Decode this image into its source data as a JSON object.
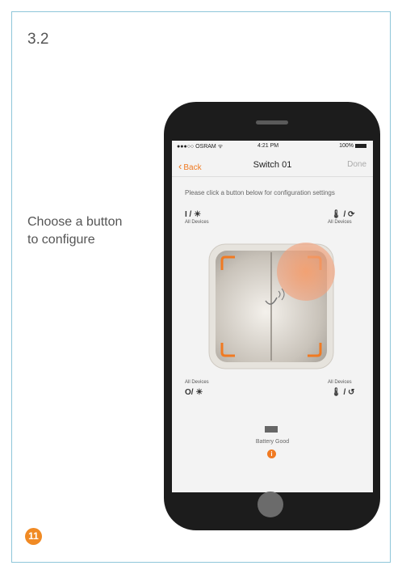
{
  "section_number": "3.2",
  "caption": {
    "line1": "Choose a button",
    "line2": "to configure"
  },
  "step_badge": "11",
  "phone": {
    "status_bar": {
      "carrier": "●●●○○ OSRAM ᯤ",
      "time": "4:21 PM",
      "battery": "100%"
    },
    "nav": {
      "back_label": "Back",
      "title": "Switch 01",
      "done_label": "Done"
    },
    "instructions": "Please click a button below for configuration settings",
    "corners": {
      "top_left": {
        "symbol": "I / ☀",
        "label": "All Devices"
      },
      "top_right": {
        "symbol": "🌡 / ⟳",
        "label": "All Devices"
      },
      "bottom_left": {
        "symbol": "O/ ☀",
        "label": "All Devices"
      },
      "bottom_right": {
        "symbol": "🌡 / ↺",
        "label": "All Devices"
      }
    },
    "battery_status": "Battery Good",
    "info_icon": "i",
    "accent_color": "#f07a22"
  }
}
